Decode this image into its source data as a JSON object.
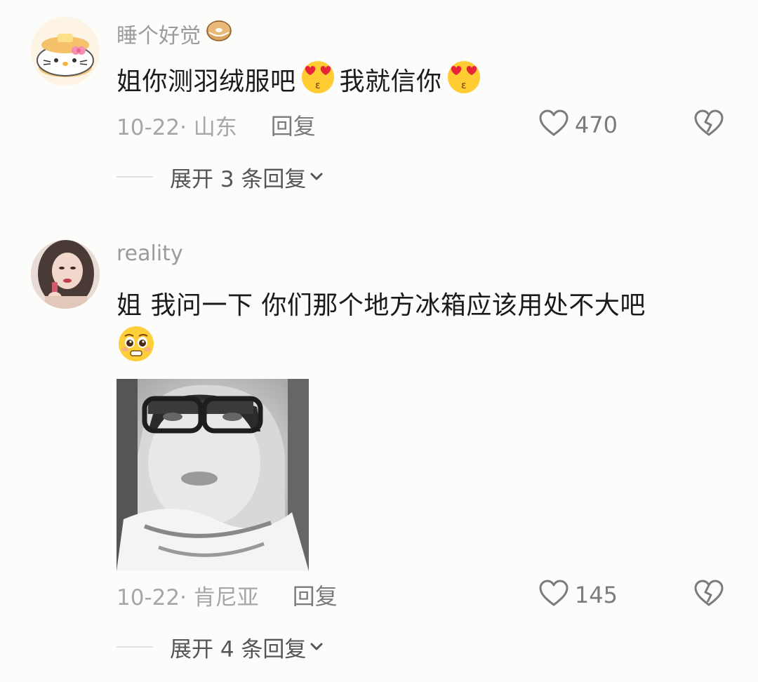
{
  "comments": [
    {
      "username": "睡个好觉",
      "username_emoji": "bagel-emoji",
      "content_parts": [
        "姐你测羽绒服吧",
        "我就信你"
      ],
      "content_emojis": [
        "heart-eyes-kiss-emoji",
        "heart-eyes-kiss-emoji"
      ],
      "date_location": "10-22· 山东",
      "reply_label": "回复",
      "like_count": "470",
      "expand_label": "展开 3 条回复"
    },
    {
      "username": "reality",
      "content": "姐 我问一下 你们那个地方冰箱应该用处不大吧",
      "content_emoji": "pleading-face-emoji",
      "date_location": "10-22· 肯尼亚",
      "reply_label": "回复",
      "like_count": "145",
      "expand_label": "展开 4 条回复"
    }
  ],
  "colors": {
    "meta_gray": "#a6a6a6",
    "text_dark": "#1b1b1b",
    "username_gray": "#9b9b9b",
    "background": "#fcfcfa"
  }
}
